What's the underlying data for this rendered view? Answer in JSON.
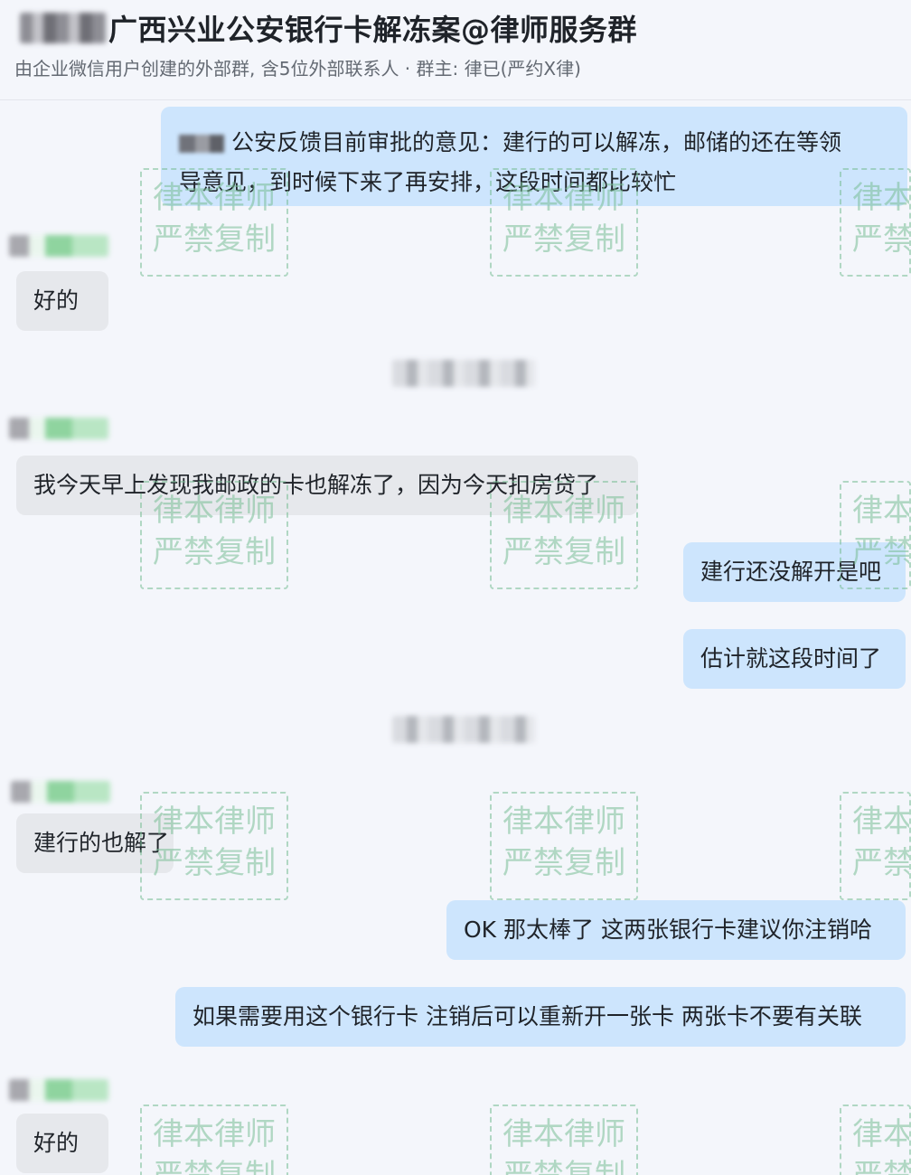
{
  "header": {
    "title": "广西兴业公安银行卡解冻案@律师服务群",
    "subtitle": "由企业微信用户创建的外部群, 含5位外部联系人 · 群主: 律已(严约X律)"
  },
  "messages": [
    {
      "from": "me",
      "text_line1": "公安反馈目前审批的意见：建行的可以解冻，邮储的还在等领",
      "text_line2": "导意见，到时候下来了再安排，这段时间都比较忙"
    },
    {
      "from": "other",
      "text": "好的"
    },
    {
      "from": "other",
      "text": "我今天早上发现我邮政的卡也解冻了，因为今天扣房贷了"
    },
    {
      "from": "me",
      "text": "建行还没解开是吧"
    },
    {
      "from": "me",
      "text": "估计就这段时间了"
    },
    {
      "from": "other",
      "text": "建行的也解了"
    },
    {
      "from": "me",
      "text": "OK 那太棒了 这两张银行卡建议你注销哈"
    },
    {
      "from": "me",
      "text": "如果需要用这个银行卡 注销后可以重新开一张卡 两张卡不要有关联"
    },
    {
      "from": "other",
      "text": "好的"
    }
  ],
  "watermark": {
    "line1": "律本律师",
    "line2": "严禁复制",
    "color": "#78be96"
  },
  "colors": {
    "my_bubble": "#cde5fd",
    "other_bubble": "#e6e8ec",
    "background": "#f4f6fb"
  }
}
